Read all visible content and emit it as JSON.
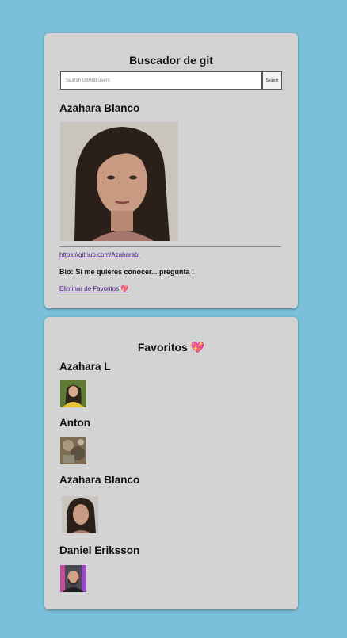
{
  "search": {
    "title": "Buscador de git",
    "placeholder": "Search GitHub users",
    "button_label": "Search"
  },
  "profile": {
    "name": "Azahara Blanco",
    "url": "https://github.com/Azaharabl",
    "bio_label": "Bio:",
    "bio": "Si me quieres conocer... pregunta !",
    "remove_favorite_label": "Eliminar de Favoritos",
    "heart": "💖"
  },
  "favorites": {
    "title": "Favoritos",
    "heart": "💖",
    "items": [
      {
        "name": "Azahara L"
      },
      {
        "name": "Anton"
      },
      {
        "name": "Azahara Blanco"
      },
      {
        "name": "Daniel Eriksson"
      }
    ]
  },
  "colors": {
    "page_background": "#7bbfd8",
    "card_background": "#d3d3d3",
    "link": "#4b1a8a",
    "heart": "#e0245e"
  }
}
